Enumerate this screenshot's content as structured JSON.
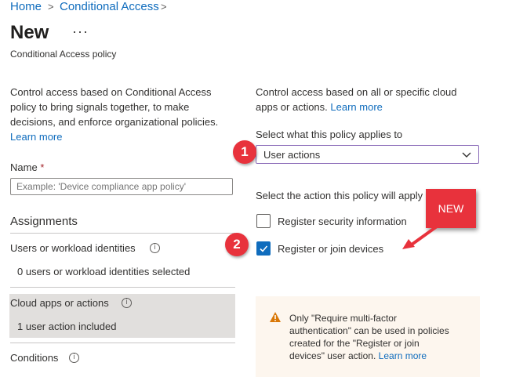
{
  "breadcrumb": {
    "home": "Home",
    "current": "Conditional Access",
    "separator": ">"
  },
  "header": {
    "title": "New",
    "more": "···",
    "subtitle": "Conditional Access policy"
  },
  "left": {
    "intro": "Control access based on Conditional Access policy to bring signals together, to make decisions, and enforce organizational policies.",
    "learn_more": "Learn more",
    "name_label": "Name",
    "required_mark": "*",
    "name_placeholder": "Example: 'Device compliance app policy'",
    "assignments_heading": "Assignments",
    "users": {
      "label": "Users or workload identities",
      "value": "0 users or workload identities selected"
    },
    "cloud_apps": {
      "label": "Cloud apps or actions",
      "value": "1 user action included"
    },
    "conditions": {
      "label": "Conditions"
    }
  },
  "right": {
    "intro_line1": "Control access based on all or specific cloud",
    "intro_line2": "apps or actions.",
    "learn_more": "Learn more",
    "select_label": "Select what this policy applies to",
    "select_value": "User actions",
    "action_label": "Select the action this policy will apply",
    "options": [
      {
        "label": "Register security information",
        "checked": false
      },
      {
        "label": "Register or join devices",
        "checked": true
      }
    ],
    "warning": {
      "line1": "Only \"Require multi-factor",
      "line2": "authentication\" can be used in policies",
      "line3": "created for the \"Register or join",
      "line4": "devices\" user action.",
      "learn_more": "Learn more"
    }
  },
  "annotations": {
    "badge1": "1",
    "badge2": "2",
    "new_label": "NEW"
  },
  "colors": {
    "link": "#0f6cbd",
    "accent_red": "#e8323c",
    "checkbox": "#0f6cbd",
    "warning": "#d97706"
  }
}
